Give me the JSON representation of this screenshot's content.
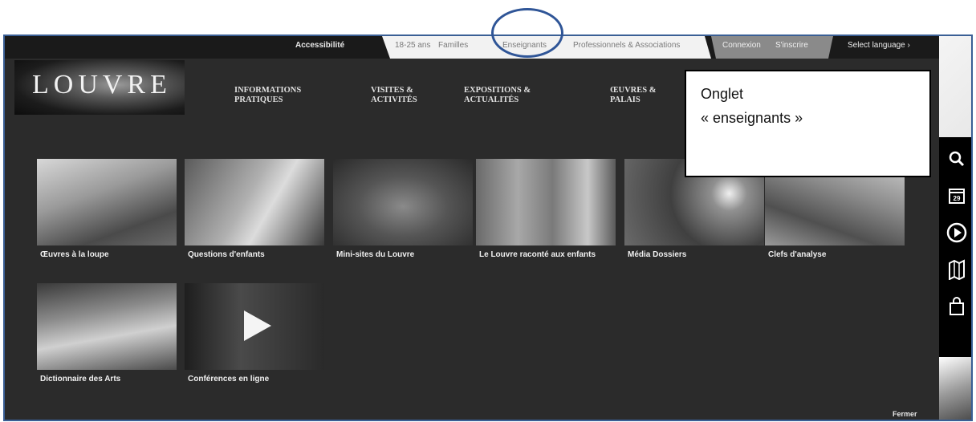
{
  "topbar": {
    "accessibility": "Accessibilité",
    "audience_tabs": [
      "18-25 ans",
      "Familles",
      "Enseignants",
      "Professionnels & Associations"
    ],
    "account": [
      "Connexion",
      "S'inscrire"
    ],
    "language": "Select language ›"
  },
  "logo": {
    "text": "LOUVRE"
  },
  "nav": {
    "items": [
      "INFORMATIONS PRATIQUES",
      "VISITES & ACTIVITÉS",
      "EXPOSITIONS & ACTUALITÉS",
      "ŒUVRES & PALAIS"
    ]
  },
  "callout": {
    "line1": "Onglet",
    "line2": "« enseignants »"
  },
  "thumbnails": [
    "Œuvres à la loupe",
    "Questions d'enfants",
    "Mini-sites du Louvre",
    "Le Louvre raconté aux enfants",
    "Média Dossiers",
    "Clefs d'analyse",
    "Dictionnaire des Arts",
    "Conférences en ligne"
  ],
  "sidebar": {
    "icons": [
      "search-icon",
      "calendar-icon",
      "play-icon",
      "map-icon",
      "shop-bag-icon"
    ],
    "calendar_day": "29"
  },
  "footer": {
    "close": "Fermer"
  },
  "colors": {
    "frame_border": "#3a5f95",
    "highlight": "#2f5597",
    "panel": "#2b2b2b"
  }
}
